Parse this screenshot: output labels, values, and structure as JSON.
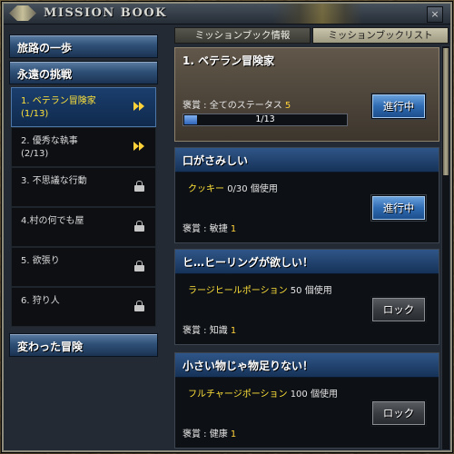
{
  "window": {
    "title": "MISSION BOOK",
    "close_label": "×"
  },
  "sidebar": {
    "categories": [
      {
        "label": "旅路の一歩"
      },
      {
        "label": "永遠の挑戦"
      },
      {
        "label": "変わった冒険"
      }
    ],
    "items": [
      {
        "label": "1. ベテラン冒険家\n(1/13)",
        "status_icon": "play-icon"
      },
      {
        "label": "2. 優秀な執事\n(2/13)",
        "status_icon": "play-icon"
      },
      {
        "label": "3. 不思議な行動",
        "status_icon": "lock-icon"
      },
      {
        "label": "4.村の何でも屋",
        "status_icon": "lock-icon"
      },
      {
        "label": "5. 欲張り",
        "status_icon": "lock-icon"
      },
      {
        "label": "6. 狩り人",
        "status_icon": "lock-icon"
      }
    ]
  },
  "tabs": [
    {
      "label": "ミッションブック情報"
    },
    {
      "label": "ミッションブックリスト"
    }
  ],
  "missions": [
    {
      "title": "1. ベテラン冒険家",
      "reward_prefix": "褒賞 : 全てのステータス",
      "reward_value": "5",
      "progress_text": "1/13",
      "progress_fraction": 0.077,
      "button": "進行中"
    },
    {
      "title": "口がさみしい",
      "req_item": "クッキー",
      "req_count": "0/30 個使用",
      "reward_prefix": "褒賞 : 敏捷",
      "reward_value": "1",
      "button": "進行中"
    },
    {
      "title": "ヒ…ヒーリングが欲しい！",
      "req_item": "ラージヒールポーション",
      "req_count": "50 個使用",
      "reward_prefix": "褒賞 : 知識",
      "reward_value": "1",
      "button": "ロック"
    },
    {
      "title": "小さい物じゃ物足りない！",
      "req_item": "フルチャージポーション",
      "req_count": "100 個使用",
      "reward_prefix": "褒賞 : 健康",
      "reward_value": "1",
      "button": "ロック"
    }
  ],
  "colors": {
    "accent": "#ffe23a",
    "panel": "#0d1014",
    "header_blue": "#2f5688"
  }
}
